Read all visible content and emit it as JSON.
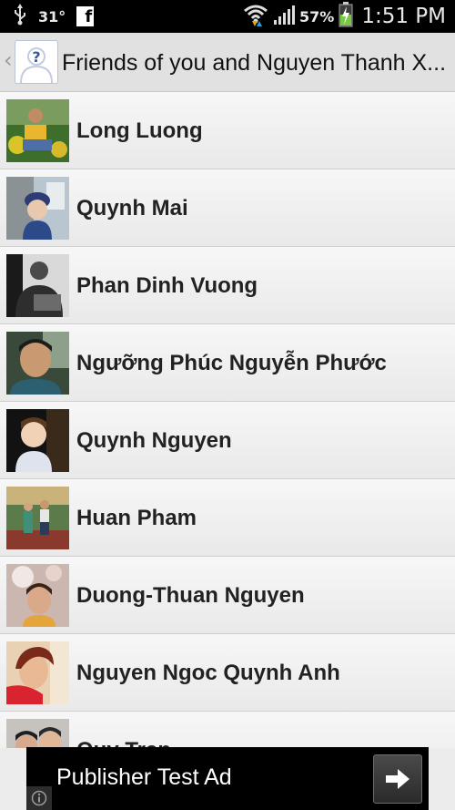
{
  "status_bar": {
    "temperature": "31°",
    "battery_percent": "57%",
    "time": "1:51 PM",
    "icons": [
      "usb-icon",
      "facebook-icon",
      "wifi-icon",
      "signal-icon",
      "battery-charging-icon"
    ]
  },
  "header": {
    "title": "Friends of you and Nguyen Thanh X...",
    "avatar_icon": "unknown-person-icon",
    "back_icon": "chevron-left-icon"
  },
  "friends": [
    {
      "name": "Long Luong"
    },
    {
      "name": "Quynh Mai"
    },
    {
      "name": "Phan Dinh Vuong"
    },
    {
      "name": "Ngưỡng Phúc Nguyễn Phước"
    },
    {
      "name": "Quynh Nguyen"
    },
    {
      "name": "Huan Pham"
    },
    {
      "name": "Duong-Thuan Nguyen"
    },
    {
      "name": "Nguyen Ngoc Quynh Anh"
    },
    {
      "name": "Quy Tran"
    }
  ],
  "ad": {
    "text": "Publisher Test Ad",
    "arrow_icon": "arrow-right-icon",
    "info_icon": "info-icon"
  }
}
